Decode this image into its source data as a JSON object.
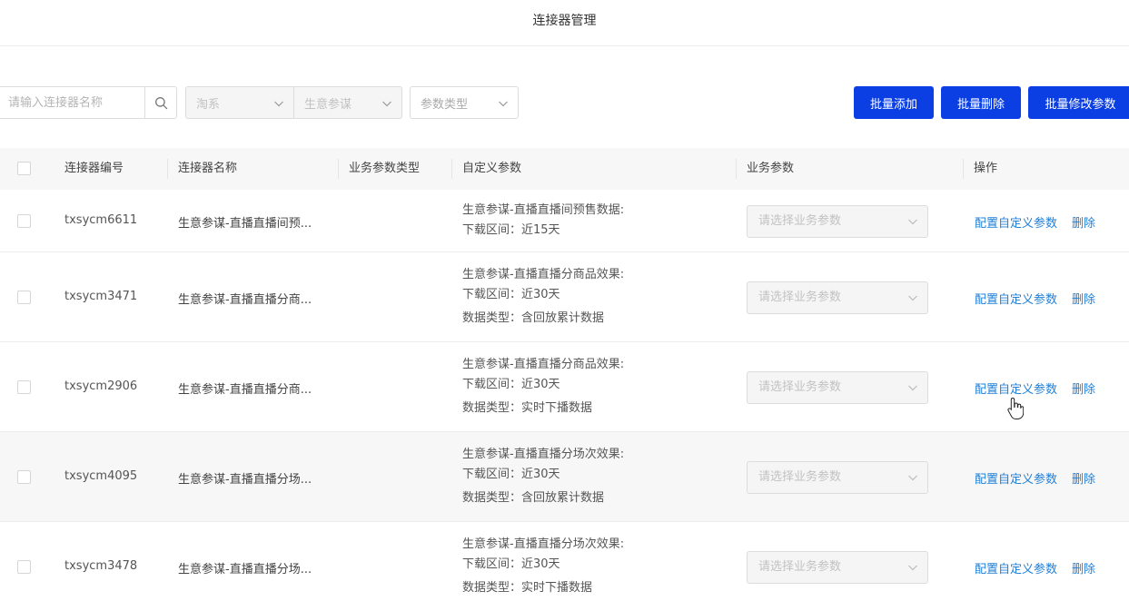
{
  "header": {
    "title": "连接器管理"
  },
  "toolbar": {
    "search_placeholder": "请输入连接器名称",
    "select_platform": "淘系",
    "select_source": "生意参谋",
    "select_param_type": "参数类型",
    "batch_add": "批量添加",
    "batch_delete": "批量删除",
    "batch_modify": "批量修改参数"
  },
  "table": {
    "columns": [
      "连接器编号",
      "连接器名称",
      "业务参数类型",
      "自定义参数",
      "业务参数",
      "操作"
    ],
    "select_placeholder": "请选择业务参数",
    "action_config": "配置自定义参数",
    "action_delete": "删除",
    "rows": [
      {
        "id": "txsycm6611",
        "name": "生意参谋-直播直播间预...",
        "params": [
          "生意参谋-直播直播间预售数据:",
          "下载区间：近15天"
        ]
      },
      {
        "id": "txsycm3471",
        "name": "生意参谋-直播直播分商...",
        "params": [
          "生意参谋-直播直播分商品效果:",
          "下载区间：近30天",
          "数据类型：含回放累计数据"
        ]
      },
      {
        "id": "txsycm2906",
        "name": "生意参谋-直播直播分商...",
        "params": [
          "生意参谋-直播直播分商品效果:",
          "下载区间：近30天",
          "数据类型：实时下播数据"
        ]
      },
      {
        "id": "txsycm4095",
        "name": "生意参谋-直播直播分场...",
        "params": [
          "生意参谋-直播直播分场次效果:",
          "下载区间：近30天",
          "数据类型：含回放累计数据"
        ]
      },
      {
        "id": "txsycm3478",
        "name": "生意参谋-直播直播分场...",
        "params": [
          "生意参谋-直播直播分场次效果:",
          "下载区间：近30天",
          "数据类型：实时下播数据"
        ]
      }
    ]
  },
  "colors": {
    "primary": "#0b3ee3",
    "link": "#1f7fd8",
    "header_bg": "#f7f7f7"
  },
  "icons": {
    "search": "search-icon",
    "dropdown": "chevron-down-icon",
    "cursor": "hand-pointer-icon"
  }
}
